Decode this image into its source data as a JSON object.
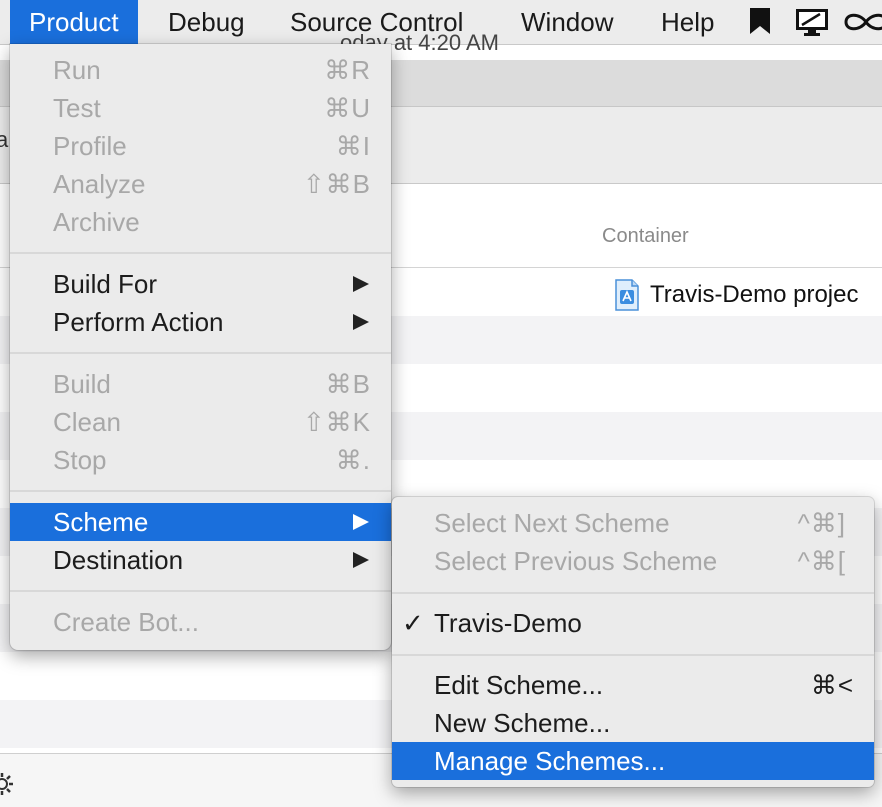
{
  "menubar": {
    "items": [
      {
        "label": "Product",
        "active": true
      },
      {
        "label": "Debug"
      },
      {
        "label": "Source Control"
      },
      {
        "label": "Window"
      },
      {
        "label": "Help"
      }
    ],
    "icons": [
      "bookmark-icon",
      "screen-share-icon",
      "infinity-icon"
    ]
  },
  "window": {
    "subtitle": "oday at 4:20 AM",
    "table": {
      "column_container": "Container",
      "row_file": "Travis-Demo projec"
    }
  },
  "product_menu": {
    "items": [
      {
        "label": "Run",
        "shortcut": "⌘R",
        "enabled": false
      },
      {
        "label": "Test",
        "shortcut": "⌘U",
        "enabled": false
      },
      {
        "label": "Profile",
        "shortcut": "⌘I",
        "enabled": false
      },
      {
        "label": "Analyze",
        "shortcut": "⇧⌘B",
        "enabled": false
      },
      {
        "label": "Archive",
        "shortcut": "",
        "enabled": false
      },
      {
        "label": "Build For",
        "submenu": true,
        "enabled": true
      },
      {
        "label": "Perform Action",
        "submenu": true,
        "enabled": true
      },
      {
        "label": "Build",
        "shortcut": "⌘B",
        "enabled": false
      },
      {
        "label": "Clean",
        "shortcut": "⇧⌘K",
        "enabled": false
      },
      {
        "label": "Stop",
        "shortcut": "⌘.",
        "enabled": false
      },
      {
        "label": "Scheme",
        "submenu": true,
        "enabled": true,
        "highlighted": true
      },
      {
        "label": "Destination",
        "submenu": true,
        "enabled": true
      },
      {
        "label": "Create Bot...",
        "shortcut": "",
        "enabled": false
      }
    ]
  },
  "scheme_menu": {
    "items": [
      {
        "label": "Select Next Scheme",
        "shortcut": "^⌘]",
        "enabled": false
      },
      {
        "label": "Select Previous Scheme",
        "shortcut": "^⌘[",
        "enabled": false
      },
      {
        "label": "Travis-Demo",
        "checkmark": "✓",
        "checked": true,
        "enabled": true
      },
      {
        "label": "Edit Scheme...",
        "shortcut": "⌘<",
        "enabled": true
      },
      {
        "label": "New Scheme...",
        "shortcut": "",
        "enabled": true
      },
      {
        "label": "Manage Schemes...",
        "shortcut": "",
        "enabled": true,
        "highlighted": true
      }
    ]
  },
  "colors": {
    "highlight": "#1a6fdc",
    "menu_bg": "#ebebeb",
    "disabled_text": "#a8a8a8"
  }
}
